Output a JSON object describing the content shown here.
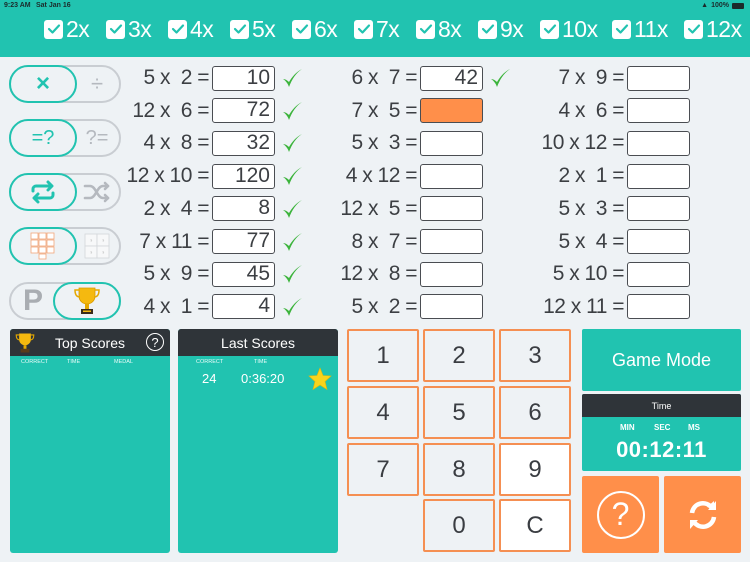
{
  "status_bar": {
    "time": "9:23 AM",
    "date": "Sat Jan 16",
    "battery": "100%"
  },
  "tables": [
    {
      "label": "2x",
      "checked": true
    },
    {
      "label": "3x",
      "checked": true
    },
    {
      "label": "4x",
      "checked": true
    },
    {
      "label": "5x",
      "checked": true
    },
    {
      "label": "6x",
      "checked": true
    },
    {
      "label": "7x",
      "checked": true
    },
    {
      "label": "8x",
      "checked": true
    },
    {
      "label": "9x",
      "checked": true
    },
    {
      "label": "10x",
      "checked": true
    },
    {
      "label": "11x",
      "checked": true
    },
    {
      "label": "12x",
      "checked": true
    }
  ],
  "toggles": {
    "operation": {
      "left": "×",
      "right": "÷",
      "selected": "left"
    },
    "question_form": {
      "left": "=?",
      "right": "?=",
      "selected": "left"
    },
    "order": {
      "left": "repeat-icon",
      "right": "shuffle-icon",
      "selected": "left"
    },
    "input": {
      "left": "keypad-icon",
      "right": "grid-icon",
      "selected": "left"
    },
    "mode": {
      "left": "P",
      "right": "trophy-icon",
      "selected": "right"
    }
  },
  "problems": {
    "col1": [
      {
        "expr": " 5 x  2 =",
        "answer": "10",
        "correct": true
      },
      {
        "expr": "12 x  6 =",
        "answer": "72",
        "correct": true
      },
      {
        "expr": " 4 x  8 =",
        "answer": "32",
        "correct": true
      },
      {
        "expr": "12 x 10 =",
        "answer": "120",
        "correct": true
      },
      {
        "expr": " 2 x  4 =",
        "answer": "8",
        "correct": true
      },
      {
        "expr": " 7 x 11 =",
        "answer": "77",
        "correct": true
      },
      {
        "expr": " 5 x  9 =",
        "answer": "45",
        "correct": true
      },
      {
        "expr": " 4 x  1 =",
        "answer": "4",
        "correct": true
      }
    ],
    "col2": [
      {
        "expr": " 6 x  7 =",
        "answer": "42",
        "correct": true
      },
      {
        "expr": " 7 x  5 =",
        "answer": "",
        "active": true
      },
      {
        "expr": " 5 x  3 =",
        "answer": ""
      },
      {
        "expr": " 4 x 12 =",
        "answer": ""
      },
      {
        "expr": "12 x  5 =",
        "answer": ""
      },
      {
        "expr": " 8 x  7 =",
        "answer": ""
      },
      {
        "expr": "12 x  8 =",
        "answer": ""
      },
      {
        "expr": " 5 x  2 =",
        "answer": ""
      }
    ],
    "col3": [
      {
        "expr": " 7 x  9 =",
        "answer": ""
      },
      {
        "expr": " 4 x  6 =",
        "answer": ""
      },
      {
        "expr": "10 x 12 =",
        "answer": ""
      },
      {
        "expr": " 2 x  1 =",
        "answer": ""
      },
      {
        "expr": " 5 x  3 =",
        "answer": ""
      },
      {
        "expr": " 5 x  4 =",
        "answer": ""
      },
      {
        "expr": " 5 x 10 =",
        "answer": ""
      },
      {
        "expr": "12 x 11 =",
        "answer": ""
      }
    ]
  },
  "top_scores": {
    "title": "Top Scores",
    "columns": [
      "CORRECT",
      "TIME",
      "MEDAL"
    ],
    "rows": []
  },
  "last_scores": {
    "title": "Last Scores",
    "columns": [
      "CORRECT",
      "TIME"
    ],
    "rows": [
      {
        "correct": "24",
        "time": "0:36:20",
        "medal": "star-icon"
      }
    ]
  },
  "keypad": [
    "1",
    "2",
    "3",
    "4",
    "5",
    "6",
    "7",
    "8",
    "9",
    "0",
    "C"
  ],
  "game_mode": {
    "label": "Game Mode"
  },
  "timer": {
    "title": "Time",
    "units": [
      "MIN",
      "SEC",
      "MS"
    ],
    "value": "00:12:11"
  },
  "colors": {
    "teal": "#21c3b0",
    "orange": "#ff8f4a",
    "dark": "#2f3439",
    "green_check": "#3cb43c"
  }
}
